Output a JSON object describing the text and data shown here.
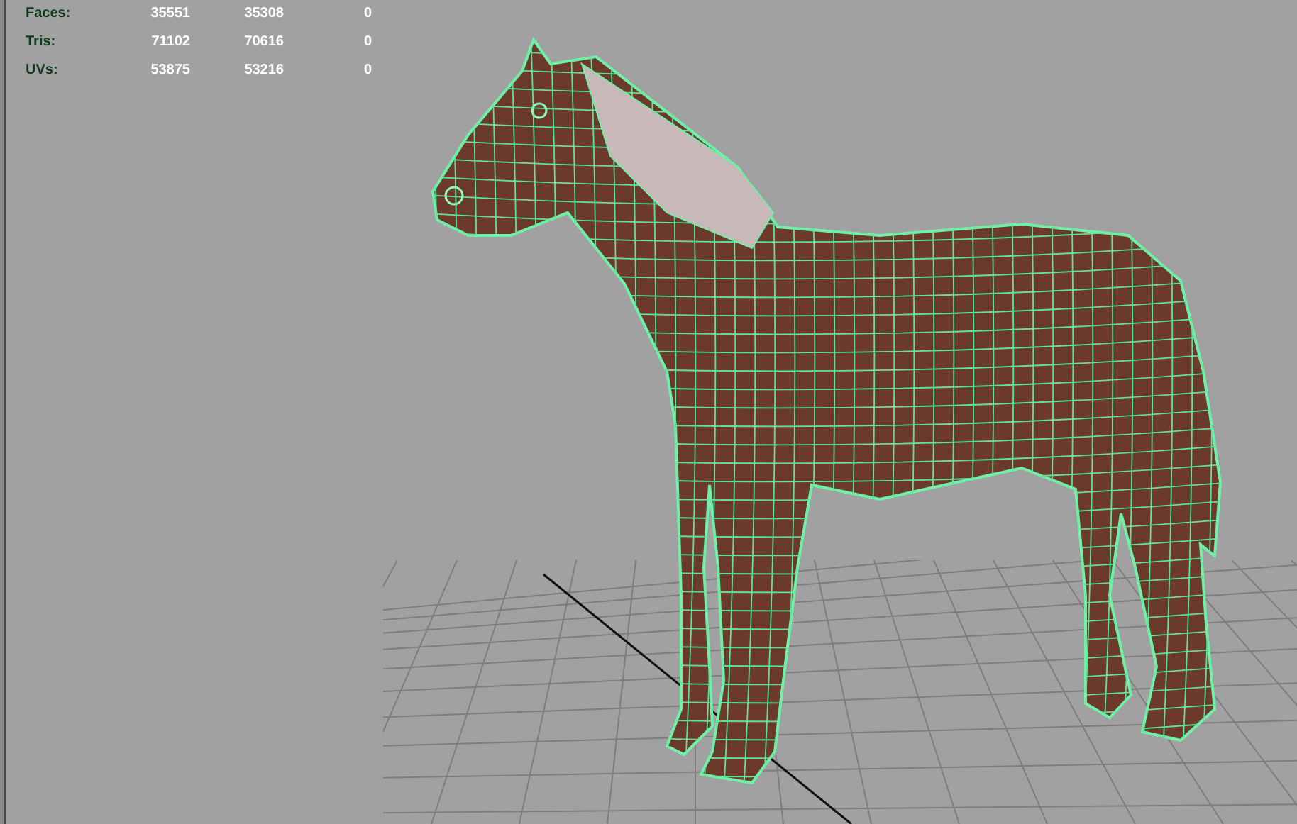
{
  "stats": [
    {
      "label": "Faces:",
      "values": [
        "35551",
        "35308",
        "0"
      ]
    },
    {
      "label": "Tris:",
      "values": [
        "71102",
        "70616",
        "0"
      ]
    },
    {
      "label": "UVs:",
      "values": [
        "53875",
        "53216",
        "0"
      ]
    }
  ]
}
